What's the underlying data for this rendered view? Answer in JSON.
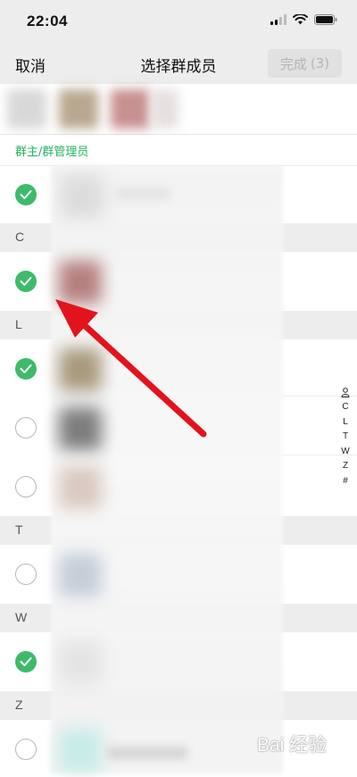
{
  "status": {
    "time": "22:04"
  },
  "nav": {
    "cancel": "取消",
    "title": "选择群成员",
    "done_label": "完成",
    "done_count": "(3)"
  },
  "sections": {
    "admins_label": "群主/群管理员",
    "C": "C",
    "L": "L",
    "T": "T",
    "W": "W",
    "Z": "Z"
  },
  "rows": [
    {
      "checked": true
    },
    {
      "checked": true
    },
    {
      "checked": true
    },
    {
      "checked": false
    },
    {
      "checked": false
    },
    {
      "checked": false
    },
    {
      "checked": true
    },
    {
      "checked": false
    }
  ],
  "index_bar": [
    "C",
    "L",
    "T",
    "W",
    "Z",
    "#"
  ],
  "watermark": "Bai 经验",
  "colors": {
    "accent_green": "#3dbb69",
    "annotation_arrow": "#e3131b",
    "nav_bg": "#ededed"
  },
  "icons": [
    "signal-icon",
    "wifi-icon",
    "battery-icon",
    "check-icon",
    "person-icon",
    "annotation-arrow"
  ]
}
